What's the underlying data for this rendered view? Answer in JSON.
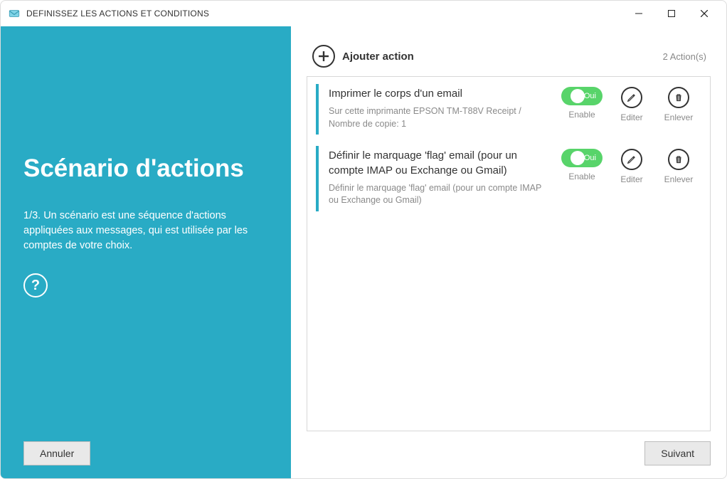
{
  "window": {
    "title": "DEFINISSEZ LES ACTIONS ET CONDITIONS"
  },
  "sidebar": {
    "heading": "Scénario d'actions",
    "description": "1/3. Un scénario est une séquence d'actions appliquées aux messages, qui est utilisée par les comptes de votre choix.",
    "help_symbol": "?",
    "cancel_label": "Annuler"
  },
  "main": {
    "add_action_label": "Ajouter action",
    "action_count": "2  Action(s)",
    "toggle_on_text": "Oui",
    "labels": {
      "enable": "Enable",
      "edit": "Editer",
      "remove": "Enlever"
    },
    "actions": [
      {
        "title": "Imprimer le corps d'un email",
        "description": "Sur cette imprimante EPSON TM-T88V Receipt / Nombre de copie: 1",
        "enabled": true
      },
      {
        "title": "Définir le marquage 'flag' email (pour un compte IMAP ou Exchange ou Gmail)",
        "description": "Définir le marquage 'flag' email (pour un compte IMAP ou Exchange ou Gmail)",
        "enabled": true
      }
    ],
    "next_label": "Suivant"
  },
  "colors": {
    "accent": "#29abc5",
    "toggle_on": "#58d46a"
  }
}
